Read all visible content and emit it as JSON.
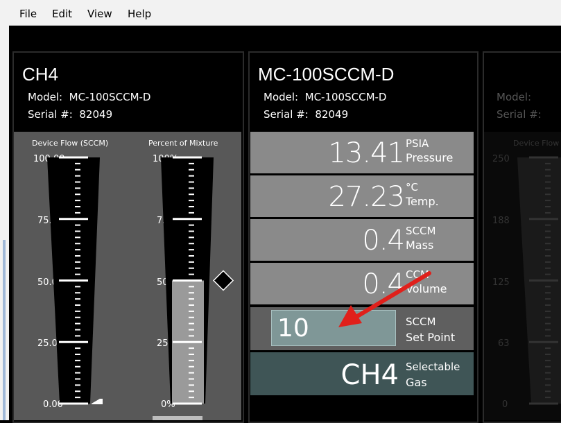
{
  "menu": {
    "items": [
      "File",
      "Edit",
      "View",
      "Help"
    ]
  },
  "left_panel": {
    "title": "CH4",
    "model_label": "Model:",
    "model_value": "MC-100SCCM-D",
    "serial_label": "Serial #:",
    "serial_value": "82049",
    "gauge_flow": {
      "label": "Device Flow (SCCM)",
      "ticks": [
        "100.00",
        "75.00",
        "50.00",
        "25.00",
        "0.00"
      ],
      "value": 0.0
    },
    "gauge_mix": {
      "label": "Percent of Mixture",
      "ticks": [
        "100%",
        "75%",
        "50%",
        "25%",
        "0%"
      ],
      "value_percent": 50
    }
  },
  "center_panel": {
    "title": "MC-100SCCM-D",
    "model_label": "Model:",
    "model_value": "MC-100SCCM-D",
    "serial_label": "Serial #:",
    "serial_value": "82049",
    "readouts": [
      {
        "value": "13.41",
        "unit": "PSIA",
        "quantity": "Pressure"
      },
      {
        "value": "27.23",
        "unit": "°C",
        "quantity": "Temp."
      },
      {
        "value": "0.4",
        "unit": "SCCM",
        "quantity": "Mass"
      },
      {
        "value": "0.4",
        "unit": "CCM",
        "quantity": "Volume"
      }
    ],
    "setpoint": {
      "value": "10",
      "unit": "SCCM",
      "quantity": "Set Point"
    },
    "gas": {
      "value": "CH4",
      "line1": "Selectable",
      "line2": "Gas"
    }
  },
  "right_panel": {
    "model_label": "Model:",
    "serial_label": "Serial #:",
    "gauge_label": "Device Flow",
    "ticks": [
      "250",
      "188",
      "125",
      "63",
      "0"
    ]
  },
  "colors": {
    "annotation_arrow": "#e0201b",
    "gas_row": "#3f5556",
    "readout": "#8a8a8a"
  }
}
